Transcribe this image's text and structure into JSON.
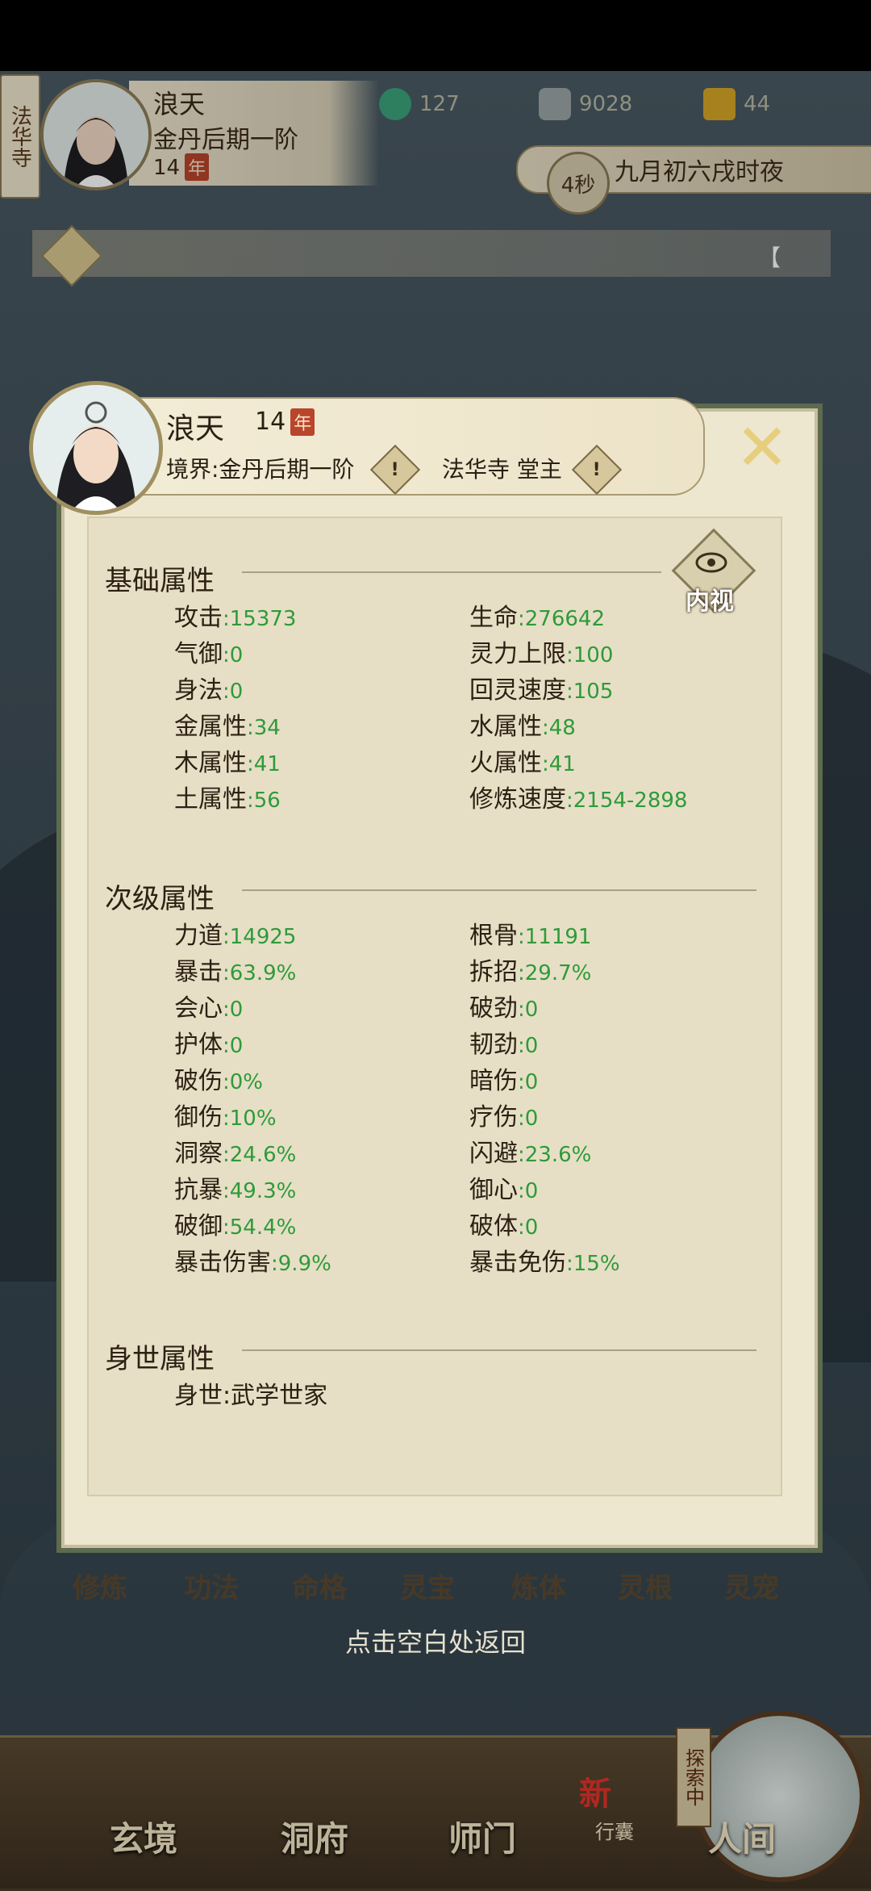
{
  "hud": {
    "temple_tag": "法华寺",
    "name": "浪天",
    "realm": "金丹后期一阶",
    "age": "14",
    "age_unit": "年",
    "resources": [
      {
        "icon": "spirit-jade-icon",
        "value": "127"
      },
      {
        "icon": "copper-coin-icon",
        "value": "9028"
      },
      {
        "icon": "strength-icon",
        "value": "44"
      }
    ],
    "timer_seconds": "4秒",
    "time_text": "九月初六戌时夜",
    "notice_bracket": "【"
  },
  "modal": {
    "name": "浪天",
    "age": "14",
    "age_unit": "年",
    "realm_label": "境界:金丹后期一阶",
    "sect_label": "法华寺 堂主",
    "eye_label": "内视",
    "basic": {
      "title": "基础属性",
      "left": [
        {
          "label": "攻击",
          "value": ":15373"
        },
        {
          "label": "气御",
          "value": ":0"
        },
        {
          "label": "身法",
          "value": ":0"
        },
        {
          "label": "金属性",
          "value": ":34"
        },
        {
          "label": "木属性",
          "value": ":41"
        },
        {
          "label": "土属性",
          "value": ":56"
        }
      ],
      "right": [
        {
          "label": "生命",
          "value": ":276642"
        },
        {
          "label": "灵力上限",
          "value": ":100"
        },
        {
          "label": "回灵速度",
          "value": ":105"
        },
        {
          "label": "水属性",
          "value": ":48"
        },
        {
          "label": "火属性",
          "value": ":41"
        },
        {
          "label": "修炼速度",
          "value": ":2154-2898"
        }
      ]
    },
    "secondary": {
      "title": "次级属性",
      "left": [
        {
          "label": "力道",
          "value": ":14925"
        },
        {
          "label": "暴击",
          "value": ":63.9%"
        },
        {
          "label": "会心",
          "value": ":0"
        },
        {
          "label": "护体",
          "value": ":0"
        },
        {
          "label": "破伤",
          "value": ":0%"
        },
        {
          "label": "御伤",
          "value": ":10%"
        },
        {
          "label": "洞察",
          "value": ":24.6%"
        },
        {
          "label": "抗暴",
          "value": ":49.3%"
        },
        {
          "label": "破御",
          "value": ":54.4%"
        },
        {
          "label": "暴击伤害",
          "value": ":9.9%"
        }
      ],
      "right": [
        {
          "label": "根骨",
          "value": ":11191"
        },
        {
          "label": "拆招",
          "value": ":29.7%"
        },
        {
          "label": "破劲",
          "value": ":0"
        },
        {
          "label": "韧劲",
          "value": ":0"
        },
        {
          "label": "暗伤",
          "value": ":0"
        },
        {
          "label": "疗伤",
          "value": ":0"
        },
        {
          "label": "闪避",
          "value": ":23.6%"
        },
        {
          "label": "御心",
          "value": ":0"
        },
        {
          "label": "破体",
          "value": ":0"
        },
        {
          "label": "暴击免伤",
          "value": ":15%"
        }
      ]
    },
    "background": {
      "title": "身世属性",
      "items": [
        {
          "label": "身世",
          "value": ":武学世家"
        }
      ]
    }
  },
  "tabs": [
    "修炼",
    "功法",
    "命格",
    "灵宝",
    "炼体",
    "灵根",
    "灵宠"
  ],
  "return_hint": "点击空白处返回",
  "nav": {
    "items": [
      "玄境",
      "洞府",
      "师门",
      "人间"
    ],
    "bag_label": "行囊",
    "bag_badge": "新",
    "explore_tag": "探索中"
  },
  "colors": {
    "value_green": "#2f9a3a",
    "panel_bg": "#eee7cf",
    "frame_green": "#5d6a4e",
    "badge_red": "#b9452b"
  }
}
